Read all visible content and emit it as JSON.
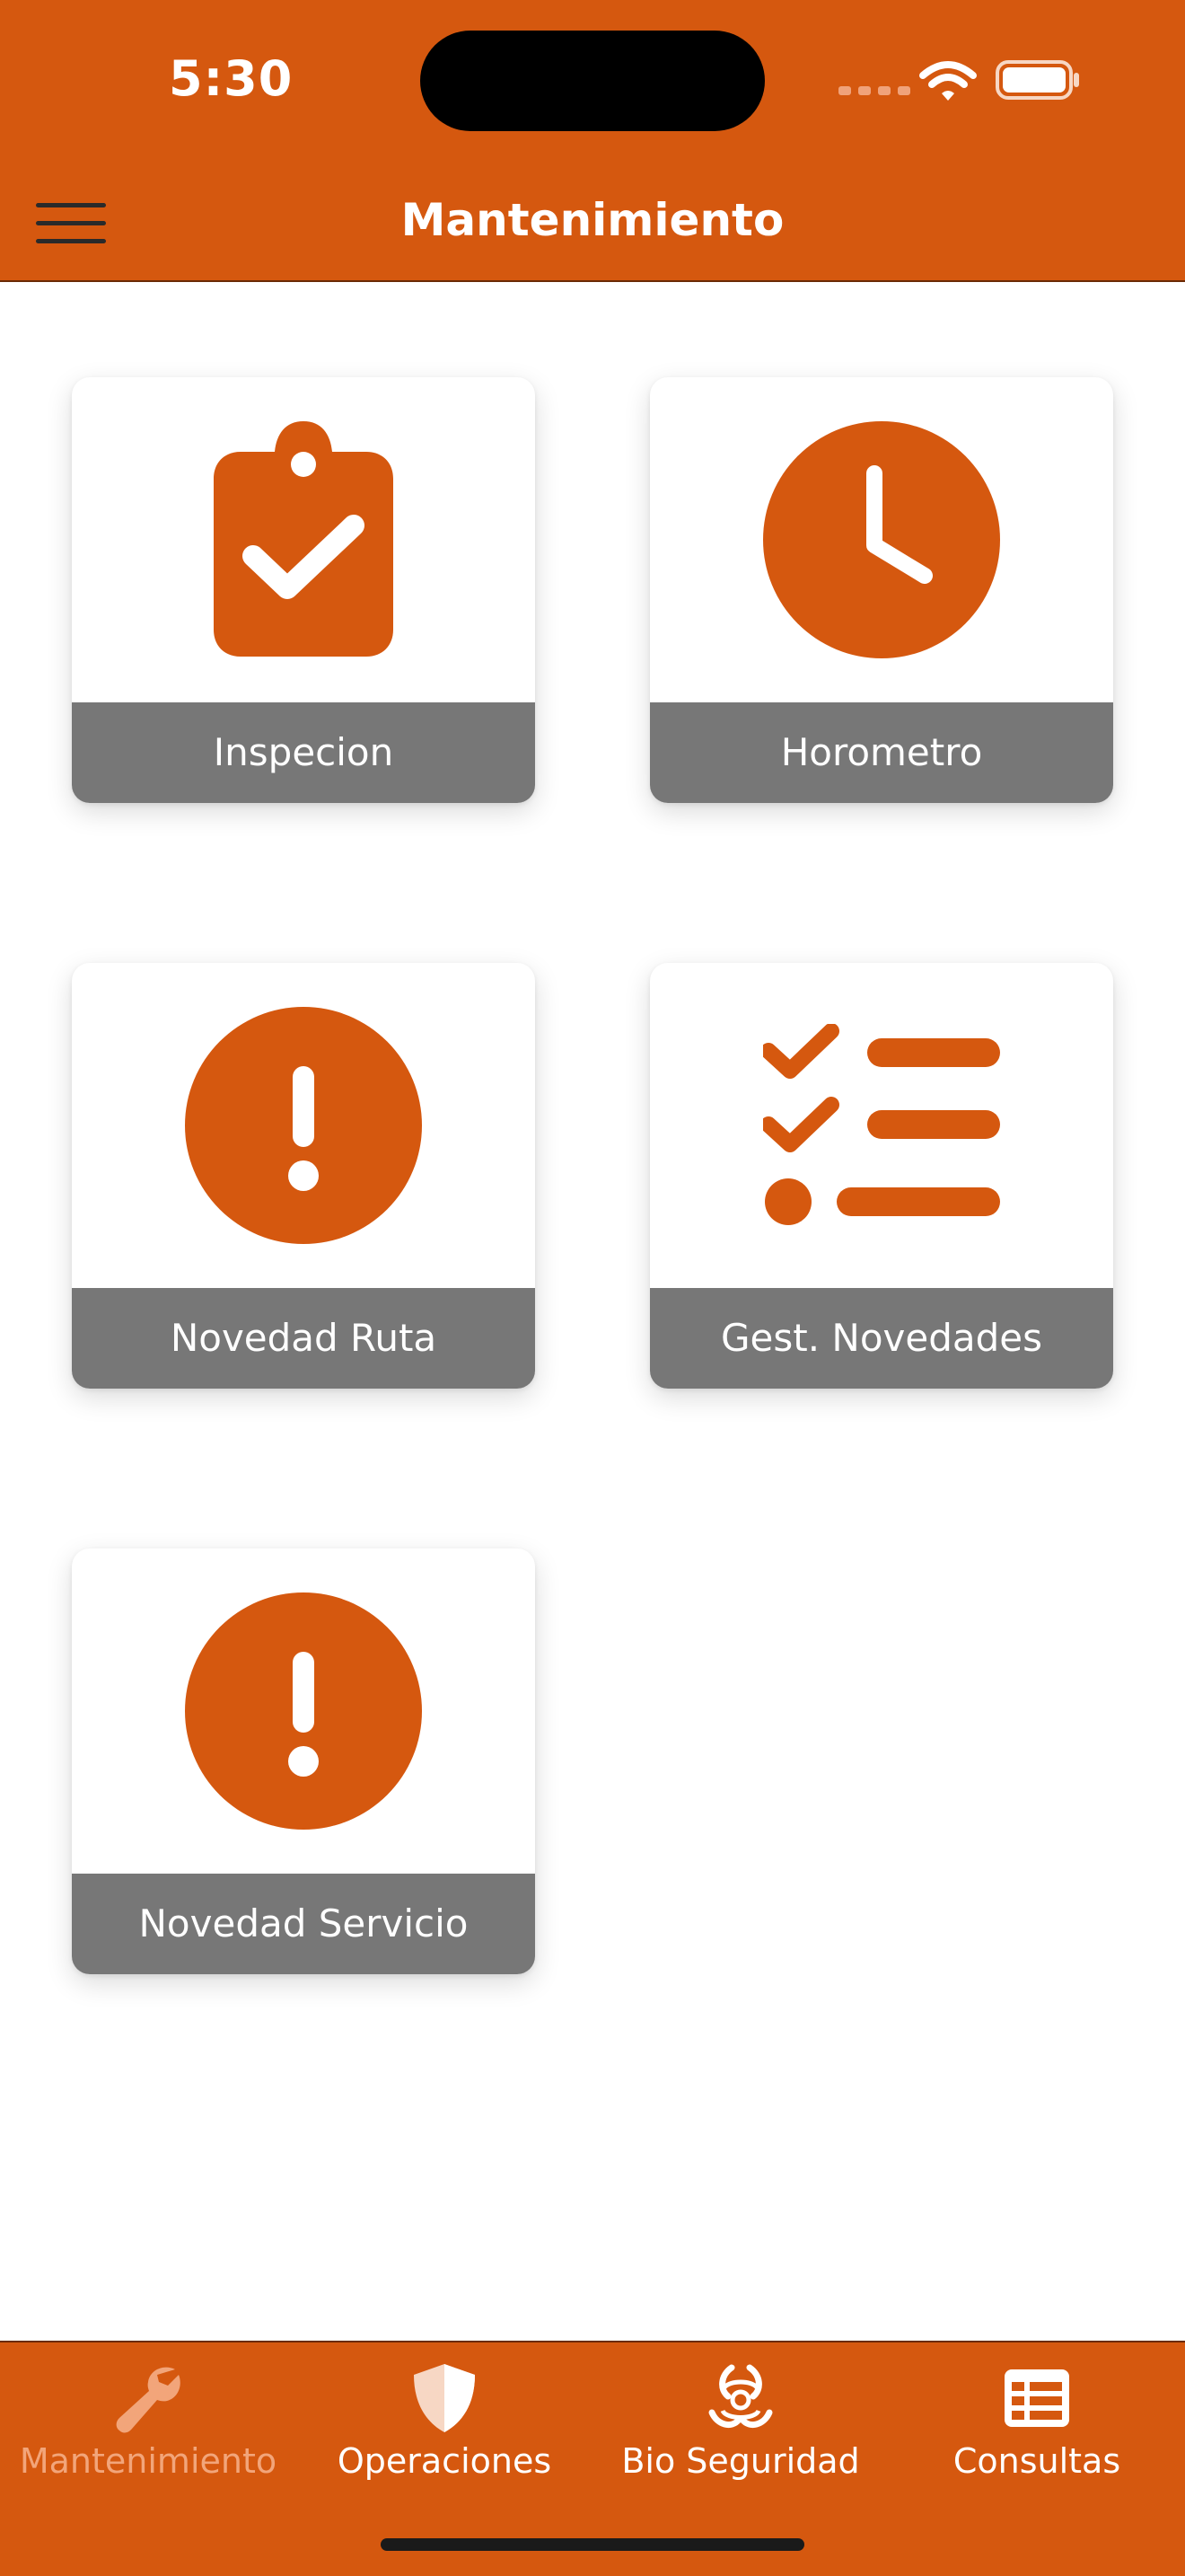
{
  "status_bar": {
    "time": "5:30"
  },
  "header": {
    "title": "Mantenimiento"
  },
  "tiles": [
    {
      "label": "Inspecion",
      "icon": "clipboard-check-icon"
    },
    {
      "label": "Horometro",
      "icon": "clock-icon"
    },
    {
      "label": "Novedad Ruta",
      "icon": "exclamation-circle-icon"
    },
    {
      "label": "Gest. Novedades",
      "icon": "checklist-icon"
    },
    {
      "label": "Novedad Servicio",
      "icon": "exclamation-circle-icon"
    }
  ],
  "tab_bar": {
    "items": [
      {
        "label": "Mantenimiento",
        "icon": "wrench-icon",
        "active": true
      },
      {
        "label": "Operaciones",
        "icon": "shield-icon",
        "active": false
      },
      {
        "label": "Bio Seguridad",
        "icon": "biohazard-icon",
        "active": false
      },
      {
        "label": "Consultas",
        "icon": "table-list-icon",
        "active": false
      }
    ]
  },
  "colors": {
    "brand_orange": "#D5580F",
    "label_gray": "#777777",
    "inactive_tab_text": "#f2a57a"
  }
}
